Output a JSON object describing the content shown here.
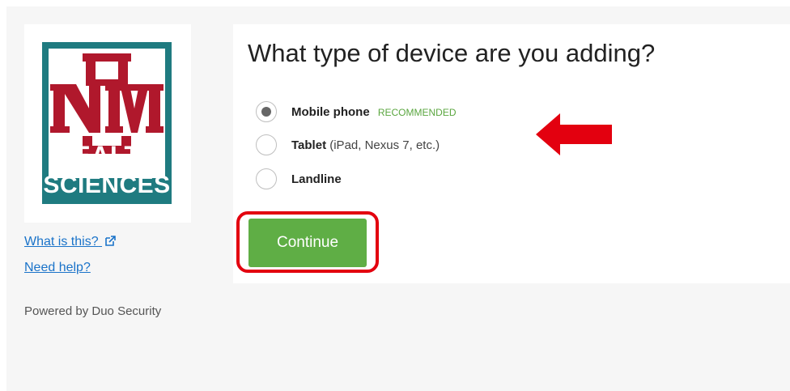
{
  "logo": {
    "line1": "HEALTH",
    "line2": "SCIENCES",
    "monogram": "UNM",
    "brand_color": "#1f7b80",
    "mark_color": "#b0182c"
  },
  "sidebar": {
    "what_is_this_label": "What is this?",
    "need_help_label": "Need help?",
    "powered_by": "Powered by Duo Security",
    "link_color": "#1a73c9"
  },
  "main": {
    "question": "What type of device are you adding?",
    "options": [
      {
        "label": "Mobile phone",
        "sub": "",
        "badge": "RECOMMENDED",
        "checked": true
      },
      {
        "label": "Tablet",
        "sub": " (iPad, Nexus 7, etc.)",
        "badge": "",
        "checked": false
      },
      {
        "label": "Landline",
        "sub": "",
        "badge": "",
        "checked": false
      }
    ],
    "continue_label": "Continue",
    "accent_color": "#5fae45"
  },
  "annotations": {
    "arrow_color": "#e3000f",
    "highlight_color": "#e3000f"
  },
  "icons": {
    "external_link": "external-link-icon",
    "logo_mark": "unm-logo-mark-icon"
  }
}
